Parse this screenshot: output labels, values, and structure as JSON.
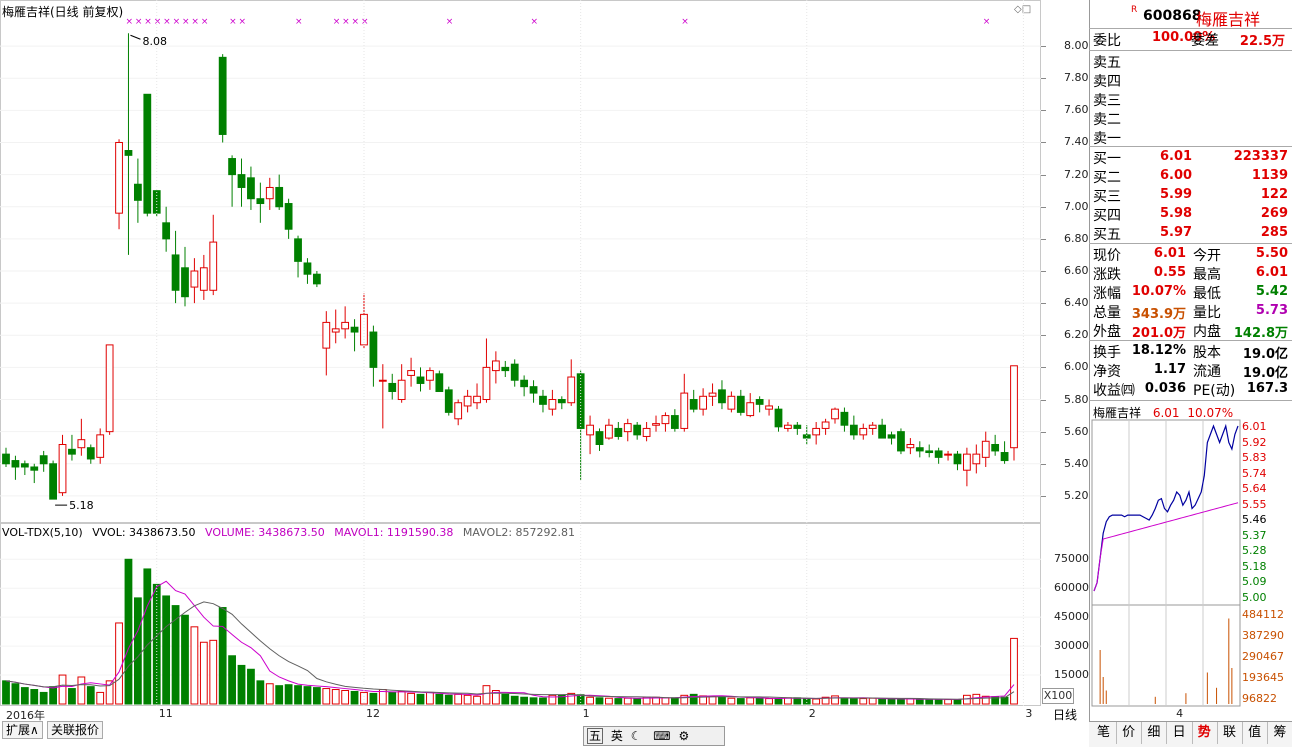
{
  "chart_header": {
    "title": "梅雁吉祥(日线 前复权)",
    "high_marker": "8.08",
    "low_marker": "5.18"
  },
  "price_axis": [
    "8.00",
    "7.80",
    "7.60",
    "7.40",
    "7.20",
    "7.00",
    "6.80",
    "6.60",
    "6.40",
    "6.20",
    "6.00",
    "5.80",
    "5.60",
    "5.40",
    "5.20"
  ],
  "volume_axis": [
    "75000",
    "60000",
    "45000",
    "30000",
    "15000"
  ],
  "volume_unit": "X100",
  "volume_legend": {
    "name": "VOL-TDX(5,10)",
    "vvol": "VVOL: 3438673.50",
    "volume": "VOLUME: 3438673.50",
    "mavol1": "MAVOL1: 1191590.38",
    "mavol2": "MAVOL2: 857292.81"
  },
  "date_axis": [
    "2016年",
    "11",
    "12",
    "1",
    "2",
    "3",
    "4"
  ],
  "bottom_tabs": [
    "扩展∧",
    "关联报价"
  ],
  "period_label": "日线",
  "ime_bar": [
    "五",
    "英",
    "☾",
    "⌨",
    "⚙"
  ],
  "quote": {
    "badge": "R",
    "code": "600868",
    "name": "梅雁吉祥",
    "weibi_label": "委比",
    "weibi": "100.00%",
    "weicha_label": "委差",
    "weicha": "22.5万",
    "sell": [
      {
        "label": "卖五",
        "price": "",
        "vol": ""
      },
      {
        "label": "卖四",
        "price": "",
        "vol": ""
      },
      {
        "label": "卖三",
        "price": "",
        "vol": ""
      },
      {
        "label": "卖二",
        "price": "",
        "vol": ""
      },
      {
        "label": "卖一",
        "price": "",
        "vol": ""
      }
    ],
    "buy": [
      {
        "label": "买一",
        "price": "6.01",
        "vol": "223337"
      },
      {
        "label": "买二",
        "price": "6.00",
        "vol": "1139"
      },
      {
        "label": "买三",
        "price": "5.99",
        "vol": "122"
      },
      {
        "label": "买四",
        "price": "5.98",
        "vol": "269"
      },
      {
        "label": "买五",
        "price": "5.97",
        "vol": "285"
      }
    ],
    "stats": [
      {
        "l1": "现价",
        "v1": "6.01",
        "c1": "#e00000",
        "l2": "今开",
        "v2": "5.50",
        "c2": "#e00000"
      },
      {
        "l1": "涨跌",
        "v1": "0.55",
        "c1": "#e00000",
        "l2": "最高",
        "v2": "6.01",
        "c2": "#e00000"
      },
      {
        "l1": "涨幅",
        "v1": "10.07%",
        "c1": "#e00000",
        "l2": "最低",
        "v2": "5.42",
        "c2": "#008000"
      },
      {
        "l1": "总量",
        "v1": "343.9万",
        "c1": "#c85000",
        "l2": "量比",
        "v2": "5.73",
        "c2": "#b000b0"
      },
      {
        "l1": "外盘",
        "v1": "201.0万",
        "c1": "#e00000",
        "l2": "内盘",
        "v2": "142.8万",
        "c2": "#008000"
      }
    ],
    "fund": [
      {
        "l1": "换手",
        "v1": "18.12%",
        "l2": "股本",
        "v2": "19.0亿"
      },
      {
        "l1": "净资",
        "v1": "1.17",
        "l2": "流通",
        "v2": "19.0亿"
      },
      {
        "l1": "收益㈣",
        "v1": "0.036",
        "l2": "PE(动)",
        "v2": "167.3"
      }
    ]
  },
  "mini": {
    "name": "梅雁吉祥",
    "price": "6.01",
    "pct": "10.07%",
    "price_axis": [
      "6.01",
      "5.92",
      "5.83",
      "5.74",
      "5.64",
      "5.55",
      "5.46",
      "5.37",
      "5.28",
      "5.18",
      "5.09",
      "5.00"
    ],
    "vol_axis": [
      "484112",
      "387290",
      "290467",
      "193645",
      "96822"
    ]
  },
  "right_tabs": [
    "笔",
    "价",
    "细",
    "日",
    "势",
    "联",
    "值",
    "筹"
  ],
  "colors": {
    "up": "#e00000",
    "down": "#008000",
    "ma1": "#cc00cc",
    "ma2": "#606060"
  },
  "chart_data": {
    "type": "candlestick",
    "title": "梅雁吉祥(日线 前复权)",
    "ylim": [
      5.05,
      8.15
    ],
    "y_unit": "price",
    "volume_ylim": [
      0,
      85000
    ],
    "candles": [
      [
        5.46,
        5.4,
        5.5,
        5.38
      ],
      [
        5.42,
        5.38,
        5.45,
        5.3
      ],
      [
        5.4,
        5.38,
        5.42,
        5.33
      ],
      [
        5.38,
        5.36,
        5.4,
        5.28
      ],
      [
        5.45,
        5.4,
        5.48,
        5.35
      ],
      [
        5.4,
        5.18,
        5.42,
        5.18
      ],
      [
        5.22,
        5.52,
        5.58,
        5.2
      ],
      [
        5.49,
        5.46,
        5.58,
        5.42
      ],
      [
        5.5,
        5.55,
        5.68,
        5.45
      ],
      [
        5.5,
        5.43,
        5.52,
        5.4
      ],
      [
        5.44,
        5.58,
        5.62,
        5.4
      ],
      [
        5.6,
        6.14,
        6.14,
        5.58
      ],
      [
        6.96,
        7.4,
        7.42,
        6.86
      ],
      [
        7.35,
        7.32,
        8.08,
        6.7
      ],
      [
        7.14,
        7.04,
        7.3,
        6.9
      ],
      [
        7.7,
        6.96,
        7.7,
        6.94
      ],
      [
        7.1,
        6.96,
        7.08,
        6.94
      ],
      [
        6.9,
        6.8,
        7.0,
        6.72
      ],
      [
        6.7,
        6.48,
        6.85,
        6.4
      ],
      [
        6.62,
        6.44,
        6.75,
        6.38
      ],
      [
        6.5,
        6.6,
        6.68,
        6.4
      ],
      [
        6.48,
        6.62,
        6.7,
        6.42
      ],
      [
        6.48,
        6.78,
        6.95,
        6.45
      ],
      [
        7.93,
        7.45,
        7.95,
        7.4
      ],
      [
        7.3,
        7.2,
        7.32,
        7.0
      ],
      [
        7.2,
        7.12,
        7.3,
        7.0
      ],
      [
        7.18,
        7.05,
        7.25,
        6.98
      ],
      [
        7.05,
        7.02,
        7.15,
        6.9
      ],
      [
        7.05,
        7.12,
        7.18,
        6.98
      ],
      [
        7.12,
        7.0,
        7.2,
        6.98
      ],
      [
        7.02,
        6.86,
        7.05,
        6.8
      ],
      [
        6.8,
        6.66,
        6.82,
        6.56
      ],
      [
        6.65,
        6.58,
        6.68,
        6.52
      ],
      [
        6.58,
        6.52,
        6.6,
        6.5
      ],
      [
        6.12,
        6.28,
        6.35,
        5.95
      ],
      [
        6.22,
        6.24,
        6.36,
        6.15
      ],
      [
        6.24,
        6.28,
        6.38,
        6.18
      ],
      [
        6.25,
        6.22,
        6.3,
        6.1
      ],
      [
        6.14,
        6.33,
        6.46,
        6.12
      ],
      [
        6.22,
        6.0,
        6.26,
        5.88
      ],
      [
        5.92,
        5.92,
        6.02,
        5.62
      ],
      [
        5.9,
        5.85,
        5.96,
        5.8
      ],
      [
        5.8,
        5.92,
        6.02,
        5.78
      ],
      [
        5.95,
        5.98,
        6.06,
        5.88
      ],
      [
        5.94,
        5.9,
        6.0,
        5.85
      ],
      [
        5.92,
        5.98,
        6.0,
        5.86
      ],
      [
        5.96,
        5.85,
        5.98,
        5.85
      ],
      [
        5.86,
        5.72,
        5.88,
        5.7
      ],
      [
        5.68,
        5.78,
        5.8,
        5.64
      ],
      [
        5.76,
        5.82,
        5.86,
        5.72
      ],
      [
        5.78,
        5.82,
        5.9,
        5.74
      ],
      [
        5.8,
        6.0,
        6.18,
        5.78
      ],
      [
        5.98,
        6.04,
        6.1,
        5.9
      ],
      [
        6.0,
        5.98,
        6.04,
        5.94
      ],
      [
        6.02,
        5.92,
        6.05,
        5.88
      ],
      [
        5.92,
        5.88,
        5.95,
        5.82
      ],
      [
        5.88,
        5.84,
        5.92,
        5.78
      ],
      [
        5.82,
        5.77,
        5.86,
        5.72
      ],
      [
        5.74,
        5.8,
        5.86,
        5.7
      ],
      [
        5.8,
        5.78,
        5.82,
        5.74
      ],
      [
        5.78,
        5.94,
        6.05,
        5.76
      ],
      [
        5.96,
        5.62,
        5.98,
        5.3
      ],
      [
        5.58,
        5.64,
        5.7,
        5.46
      ],
      [
        5.6,
        5.52,
        5.62,
        5.48
      ],
      [
        5.56,
        5.64,
        5.68,
        5.55
      ],
      [
        5.62,
        5.57,
        5.66,
        5.55
      ],
      [
        5.6,
        5.65,
        5.68,
        5.54
      ],
      [
        5.64,
        5.58,
        5.66,
        5.55
      ],
      [
        5.57,
        5.62,
        5.66,
        5.54
      ],
      [
        5.64,
        5.65,
        5.7,
        5.6
      ],
      [
        5.65,
        5.7,
        5.72,
        5.6
      ],
      [
        5.7,
        5.62,
        5.74,
        5.6
      ],
      [
        5.62,
        5.84,
        5.96,
        5.6
      ],
      [
        5.8,
        5.74,
        5.86,
        5.72
      ],
      [
        5.74,
        5.82,
        5.87,
        5.7
      ],
      [
        5.82,
        5.84,
        5.9,
        5.76
      ],
      [
        5.86,
        5.78,
        5.92,
        5.74
      ],
      [
        5.74,
        5.82,
        5.85,
        5.72
      ],
      [
        5.82,
        5.72,
        5.86,
        5.7
      ],
      [
        5.7,
        5.78,
        5.84,
        5.69
      ],
      [
        5.8,
        5.77,
        5.82,
        5.72
      ],
      [
        5.74,
        5.76,
        5.8,
        5.7
      ],
      [
        5.74,
        5.63,
        5.76,
        5.6
      ],
      [
        5.62,
        5.64,
        5.66,
        5.6
      ],
      [
        5.64,
        5.62,
        5.66,
        5.58
      ],
      [
        5.58,
        5.56,
        5.64,
        5.52
      ],
      [
        5.58,
        5.62,
        5.66,
        5.52
      ],
      [
        5.62,
        5.66,
        5.68,
        5.58
      ],
      [
        5.68,
        5.74,
        5.75,
        5.65
      ],
      [
        5.72,
        5.64,
        5.75,
        5.6
      ],
      [
        5.64,
        5.58,
        5.7,
        5.55
      ],
      [
        5.58,
        5.62,
        5.65,
        5.55
      ],
      [
        5.62,
        5.64,
        5.66,
        5.58
      ],
      [
        5.64,
        5.56,
        5.68,
        5.56
      ],
      [
        5.58,
        5.56,
        5.6,
        5.52
      ],
      [
        5.6,
        5.48,
        5.62,
        5.46
      ],
      [
        5.5,
        5.52,
        5.56,
        5.46
      ],
      [
        5.5,
        5.48,
        5.54,
        5.44
      ],
      [
        5.48,
        5.47,
        5.52,
        5.44
      ],
      [
        5.48,
        5.44,
        5.5,
        5.4
      ],
      [
        5.46,
        5.46,
        5.48,
        5.42
      ],
      [
        5.46,
        5.4,
        5.48,
        5.36
      ],
      [
        5.36,
        5.46,
        5.5,
        5.26
      ],
      [
        5.4,
        5.46,
        5.52,
        5.34
      ],
      [
        5.44,
        5.54,
        5.6,
        5.38
      ],
      [
        5.52,
        5.48,
        5.58,
        5.45
      ],
      [
        5.47,
        5.42,
        5.54,
        5.4
      ],
      [
        5.5,
        6.01,
        6.01,
        5.42
      ]
    ],
    "volume": [
      12000,
      10500,
      8500,
      7500,
      6000,
      9000,
      15000,
      8000,
      14000,
      9000,
      6000,
      12000,
      42000,
      75000,
      55000,
      70000,
      62000,
      56000,
      51000,
      46000,
      40000,
      32000,
      33000,
      50000,
      25000,
      20000,
      18000,
      12000,
      10500,
      9500,
      10000,
      9500,
      9000,
      8500,
      8000,
      7500,
      7000,
      6500,
      6000,
      5500,
      7500,
      6000,
      6500,
      5500,
      5000,
      6000,
      5000,
      4500,
      5000,
      4500,
      4000,
      9500,
      7000,
      5000,
      4000,
      3500,
      3200,
      3100,
      4500,
      4500,
      5500,
      4800,
      3500,
      3200,
      3000,
      2800,
      3000,
      2800,
      3500,
      3500,
      3200,
      3200,
      4500,
      5000,
      4200,
      4000,
      3800,
      3000,
      2800,
      3200,
      3000,
      2800,
      2600,
      3200,
      3200,
      2800,
      2600,
      3500,
      4200,
      3000,
      2600,
      2800,
      3000,
      2600,
      2500,
      2400,
      2600,
      2500,
      2400,
      2200,
      2300,
      2300,
      4500,
      5000,
      4000,
      3800,
      3500,
      34000
    ]
  }
}
